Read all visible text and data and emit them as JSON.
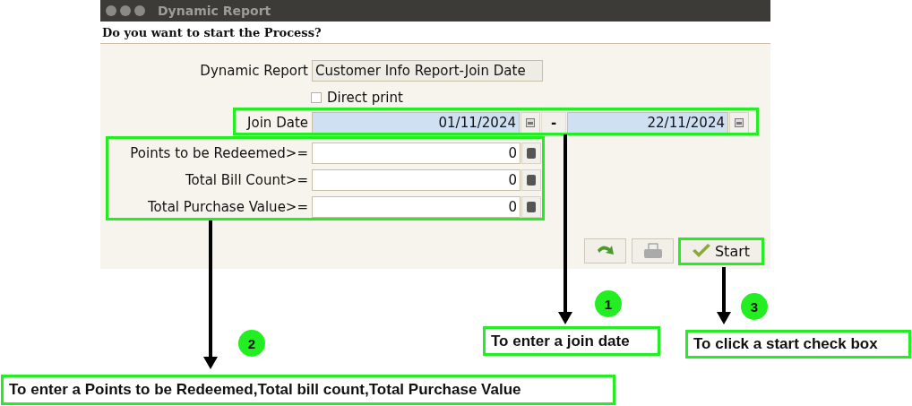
{
  "window": {
    "title": "Dynamic Report"
  },
  "prompt": "Do you want to start the Process?",
  "report": {
    "label": "Dynamic Report",
    "value": "Customer Info Report-Join Date"
  },
  "direct_print": {
    "label": "Direct print",
    "checked": false
  },
  "join_date": {
    "label": "Join Date",
    "from": "01/11/2024",
    "separator": "-",
    "to": "22/11/2024"
  },
  "filters": [
    {
      "label": "Points to be Redeemed>=",
      "value": "0"
    },
    {
      "label": "Total Bill Count>=",
      "value": "0"
    },
    {
      "label": "Total Purchase Value>=",
      "value": "0"
    }
  ],
  "buttons": {
    "start": "Start"
  },
  "annotations": [
    {
      "number": "1",
      "text": "To enter a join date"
    },
    {
      "number": "2",
      "text": "To enter a Points to be Redeemed,Total bill count,Total Purchase Value"
    },
    {
      "number": "3",
      "text": "To click a start check box"
    }
  ]
}
